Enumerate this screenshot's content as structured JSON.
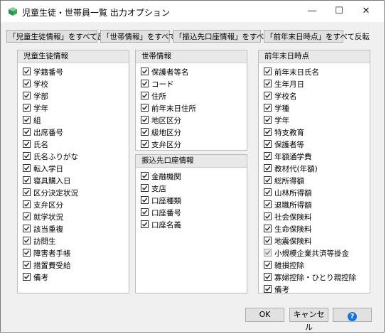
{
  "window": {
    "title": "児童生徒・世帯員一覧  出力オプション",
    "minimize": "—",
    "maximize": "☐",
    "close": "✕"
  },
  "toolbar": {
    "buttons": [
      "「児童生徒情報」をすべて反転",
      "「世帯情報」をすべて反転",
      "「振込先口座情報」をすべて反転",
      "「前年末日時点」をすべて反転"
    ]
  },
  "panels": {
    "student": {
      "header": "児童生徒情報",
      "items": [
        {
          "label": "学籍番号",
          "checked": true
        },
        {
          "label": "学校",
          "checked": true
        },
        {
          "label": "学部",
          "checked": true
        },
        {
          "label": "学年",
          "checked": true
        },
        {
          "label": "組",
          "checked": true
        },
        {
          "label": "出席番号",
          "checked": true
        },
        {
          "label": "氏名",
          "checked": true
        },
        {
          "label": "氏名ふりがな",
          "checked": true
        },
        {
          "label": "転入学日",
          "checked": true
        },
        {
          "label": "寝具購入日",
          "checked": true
        },
        {
          "label": "区分決定状況",
          "checked": true
        },
        {
          "label": "支弁区分",
          "checked": true
        },
        {
          "label": "就学状況",
          "checked": true
        },
        {
          "label": "該当重複",
          "checked": true
        },
        {
          "label": "訪問生",
          "checked": true
        },
        {
          "label": "障害者手帳",
          "checked": true
        },
        {
          "label": "措置費受給",
          "checked": true
        },
        {
          "label": "備考",
          "checked": true
        }
      ]
    },
    "household": {
      "header": "世帯情報",
      "items": [
        {
          "label": "保護者等名",
          "checked": true
        },
        {
          "label": "コード",
          "checked": true
        },
        {
          "label": "住所",
          "checked": true
        },
        {
          "label": "前年末日住所",
          "checked": true
        },
        {
          "label": "地区区分",
          "checked": true
        },
        {
          "label": "級地区分",
          "checked": true
        },
        {
          "label": "支弁区分",
          "checked": true
        }
      ]
    },
    "account": {
      "header": "振込先口座情報",
      "items": [
        {
          "label": "金融機関",
          "checked": true
        },
        {
          "label": "支店",
          "checked": true
        },
        {
          "label": "口座種類",
          "checked": true
        },
        {
          "label": "口座番号",
          "checked": true
        },
        {
          "label": "口座名義",
          "checked": true
        }
      ]
    },
    "yearend": {
      "header": "前年末日時点",
      "items": [
        {
          "label": "前年末日氏名",
          "checked": true,
          "disabled": false
        },
        {
          "label": "生年月日",
          "checked": true,
          "disabled": false
        },
        {
          "label": "学校名",
          "checked": true,
          "disabled": false
        },
        {
          "label": "学種",
          "checked": true,
          "disabled": false
        },
        {
          "label": "学年",
          "checked": true,
          "disabled": false
        },
        {
          "label": "特支教育",
          "checked": true,
          "disabled": false
        },
        {
          "label": "保護者等",
          "checked": true,
          "disabled": false
        },
        {
          "label": "年額通学費",
          "checked": true,
          "disabled": false
        },
        {
          "label": "教材代(年額)",
          "checked": true,
          "disabled": false
        },
        {
          "label": "総所得額",
          "checked": true,
          "disabled": false
        },
        {
          "label": "山林所得額",
          "checked": true,
          "disabled": false
        },
        {
          "label": "退職所得額",
          "checked": true,
          "disabled": false
        },
        {
          "label": "社会保険料",
          "checked": true,
          "disabled": false
        },
        {
          "label": "生命保険料",
          "checked": true,
          "disabled": false
        },
        {
          "label": "地震保険料",
          "checked": true,
          "disabled": false
        },
        {
          "label": "小規模企業共済等掛金",
          "checked": true,
          "disabled": true
        },
        {
          "label": "雑損控除",
          "checked": true,
          "disabled": false
        },
        {
          "label": "寡婦控除・ひとり親控除",
          "checked": true,
          "disabled": false
        },
        {
          "label": "備考",
          "checked": true,
          "disabled": false
        }
      ]
    }
  },
  "buttons": {
    "ok": "OK",
    "cancel": "キャンセル",
    "help": "?"
  },
  "colors": {
    "accent": "#1a73d9",
    "icon_green": "#3aa655"
  }
}
